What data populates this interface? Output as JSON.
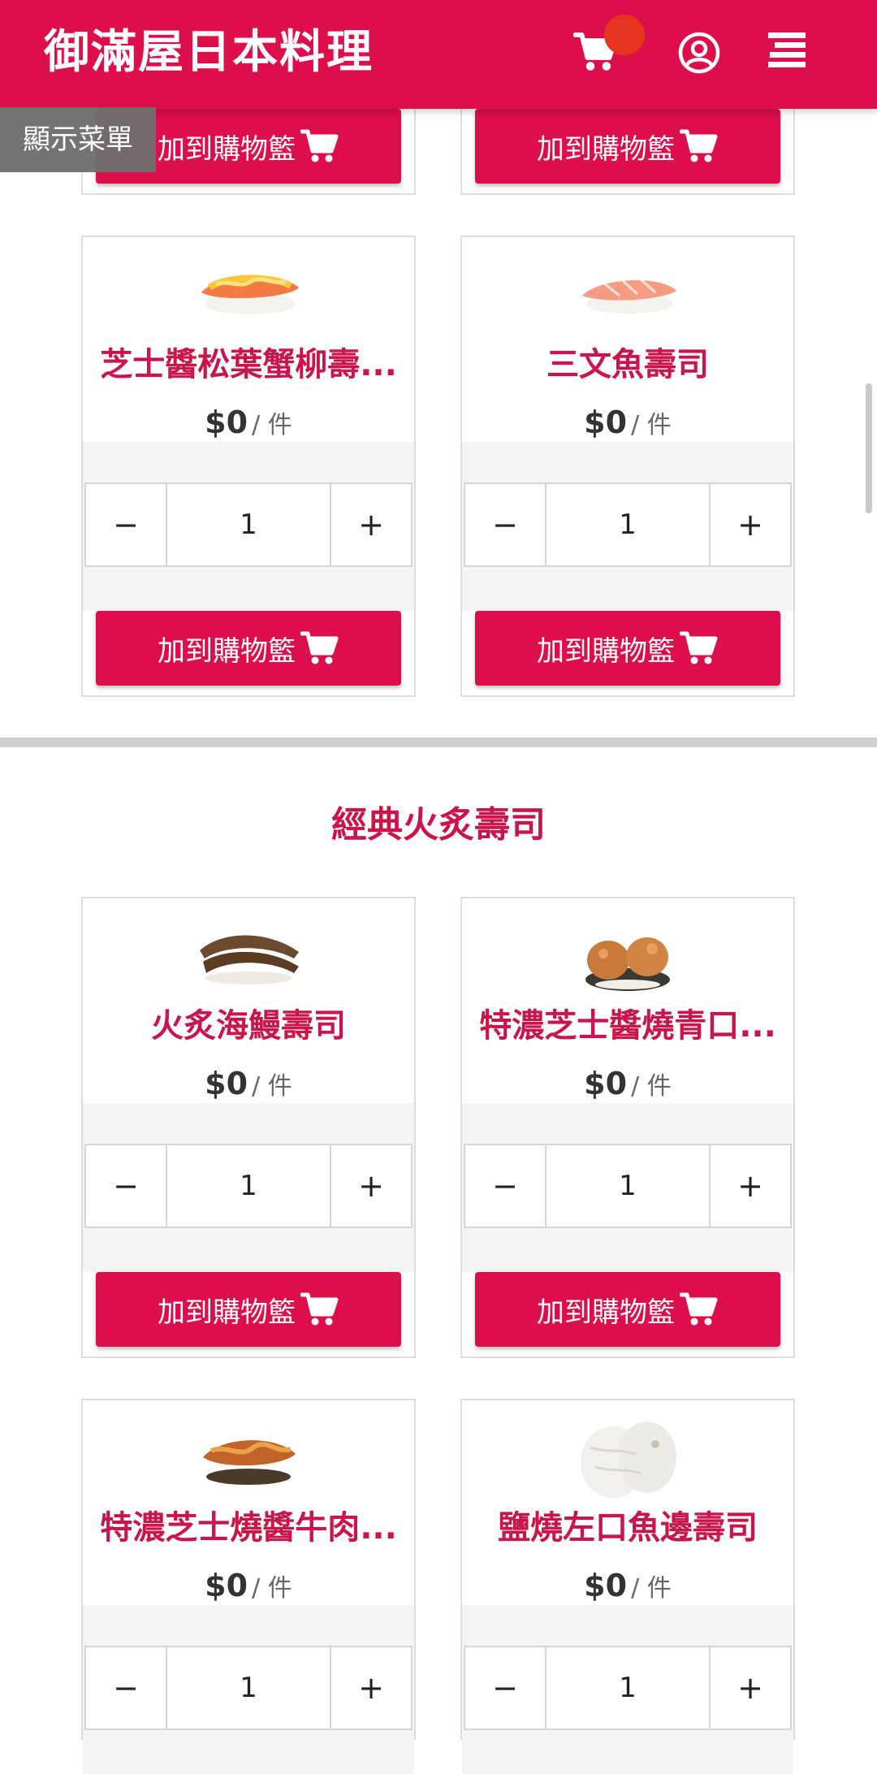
{
  "header": {
    "title": "御滿屋日本料理"
  },
  "show_menu": "顯示菜單",
  "add_to_cart_label": "加到購物籃",
  "colors": {
    "primary": "#DC0F4B",
    "title_text": "#C8154C",
    "badge": "#E5351E"
  },
  "icons": [
    "cart-icon",
    "user-circle-icon",
    "hamburger-menu-icon",
    "minus-icon",
    "plus-icon"
  ],
  "products_section_1": [
    {
      "name": "芝士醬松葉蟹柳壽...",
      "price": "$0",
      "unit": "/ 件",
      "qty": "1"
    },
    {
      "name": "三文魚壽司",
      "price": "$0",
      "unit": "/ 件",
      "qty": "1"
    }
  ],
  "section_2": {
    "title": "經典火炙壽司",
    "products": [
      {
        "name": "火炙海鰻壽司",
        "price": "$0",
        "unit": "/ 件",
        "qty": "1"
      },
      {
        "name": "特濃芝士醬燒青口...",
        "price": "$0",
        "unit": "/ 件",
        "qty": "1"
      },
      {
        "name": "特濃芝士燒醬牛肉...",
        "price": "$0",
        "unit": "/ 件",
        "qty": "1"
      },
      {
        "name": "鹽燒左口魚邊壽司",
        "price": "$0",
        "unit": "/ 件",
        "qty": "1"
      }
    ]
  },
  "stepper": {
    "minus": "−",
    "plus": "+"
  }
}
